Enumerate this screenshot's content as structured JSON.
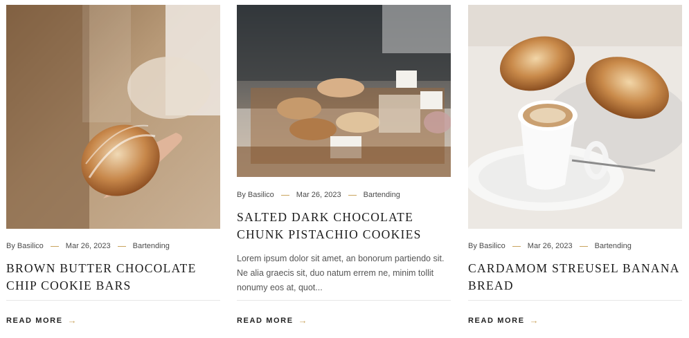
{
  "posts": [
    {
      "author": "By Basilico",
      "date": "Mar 26, 2023",
      "category": "Bartending",
      "title": "Brown Butter Chocolate Chip Cookie Bars",
      "excerpt": "",
      "read_more": "Read More",
      "arrow_icon": "arrow-right-icon"
    },
    {
      "author": "By Basilico",
      "date": "Mar 26, 2023",
      "category": "Bartending",
      "title": "Salted Dark Chocolate Chunk Pistachio Cookies",
      "excerpt": "Lorem ipsum dolor sit amet, an bonorum partiendo sit. Ne alia graecis sit, duo natum errem ne, minim tollit nonumy eos at, quot...",
      "read_more": "Read More",
      "arrow_icon": "arrow-right-icon"
    },
    {
      "author": "By Basilico",
      "date": "Mar 26, 2023",
      "category": "Bartending",
      "title": "Cardamom Streusel Banana Bread",
      "excerpt": "",
      "read_more": "Read More",
      "arrow_icon": "arrow-right-icon"
    }
  ],
  "colors": {
    "accent": "#c9a35c",
    "text": "#1b1b1b",
    "muted": "#555555",
    "divider": "#e6e6e6"
  }
}
